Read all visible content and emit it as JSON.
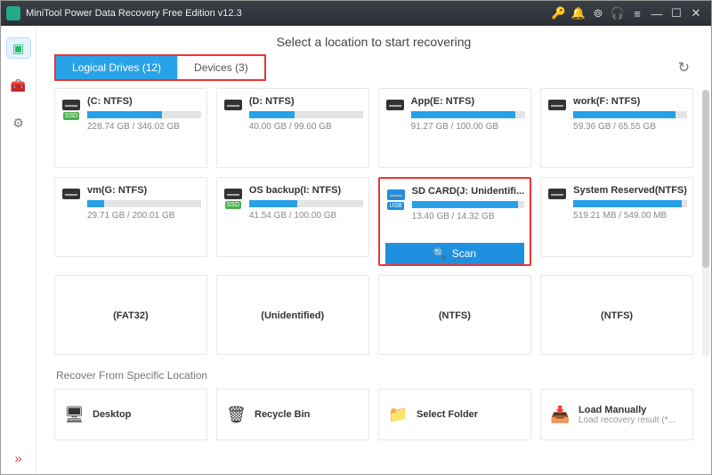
{
  "title": "MiniTool Power Data Recovery Free Edition v12.3",
  "heading": "Select a location to start recovering",
  "tabs": {
    "logical": "Logical Drives (12)",
    "devices": "Devices (3)"
  },
  "drives": [
    {
      "name": "(C: NTFS)",
      "size": "228.74 GB / 346.02 GB",
      "pct": 66,
      "tag": "SSD"
    },
    {
      "name": "(D: NTFS)",
      "size": "40.00 GB / 99.60 GB",
      "pct": 40
    },
    {
      "name": "App(E: NTFS)",
      "size": "91.27 GB / 100.00 GB",
      "pct": 91
    },
    {
      "name": "work(F: NTFS)",
      "size": "59.36 GB / 65.55 GB",
      "pct": 90
    },
    {
      "name": "vm(G: NTFS)",
      "size": "29.71 GB / 200.01 GB",
      "pct": 15
    },
    {
      "name": "OS backup(I: NTFS)",
      "size": "41.54 GB / 100.00 GB",
      "pct": 42,
      "tag": "SSD"
    },
    {
      "name": "SD CARD(J: Unidentifi...",
      "size": "13.40 GB / 14.32 GB",
      "pct": 94,
      "tag": "USB",
      "selected": true
    },
    {
      "name": "System Reserved(NTFS)",
      "size": "519.21 MB / 549.00 MB",
      "pct": 95
    },
    {
      "name": "(FAT32)",
      "min": true
    },
    {
      "name": "(Unidentified)",
      "min": true
    },
    {
      "name": "(NTFS)",
      "min": true
    },
    {
      "name": "(NTFS)",
      "min": true
    }
  ],
  "scan_label": "Scan",
  "locations_title": "Recover From Specific Location",
  "locations": [
    {
      "icon": "🖥",
      "label": "Desktop"
    },
    {
      "icon": "🗑",
      "label": "Recycle Bin"
    },
    {
      "icon": "📁",
      "label": "Select Folder"
    },
    {
      "icon": "📥",
      "label": "Load Manually",
      "sub": "Load recovery result (*..."
    }
  ]
}
